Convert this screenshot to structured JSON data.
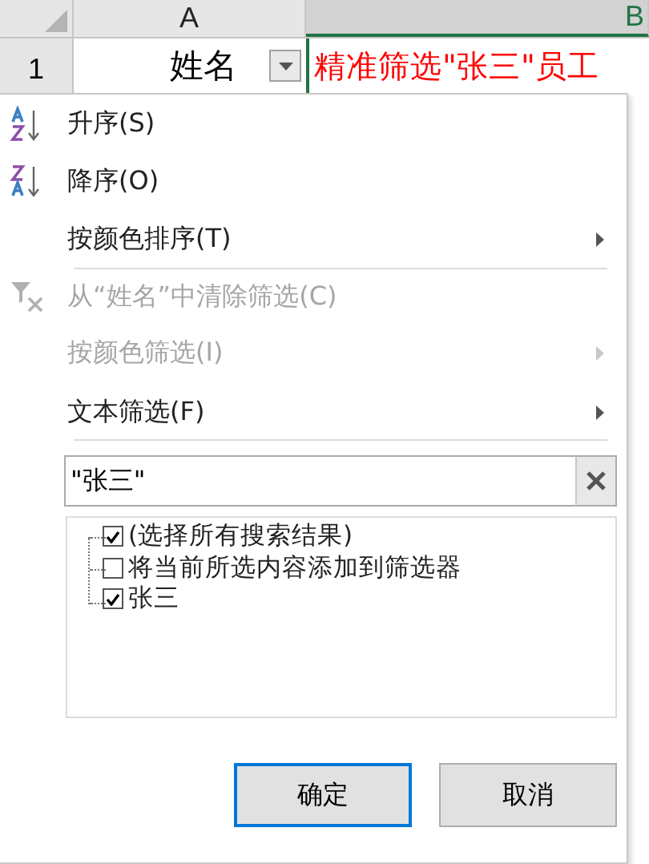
{
  "sheet": {
    "columns": [
      {
        "label": "A",
        "selected": false
      },
      {
        "label": "B",
        "selected": true
      }
    ],
    "row": {
      "number": "1",
      "cells": [
        {
          "text": "姓名",
          "has_filter": true,
          "color": "#000000"
        },
        {
          "text": "精准筛选\"张三\"员工",
          "has_filter": false,
          "color": "#ff0000"
        }
      ]
    }
  },
  "menu": {
    "items": [
      {
        "label": "升序(S)",
        "kind": "sort-ascending",
        "disabled": false,
        "submenu": false,
        "separator_after": false
      },
      {
        "label": "降序(O)",
        "kind": "sort-descending",
        "disabled": false,
        "submenu": false,
        "separator_after": false
      },
      {
        "label": "按颜色排序(T)",
        "kind": "plain",
        "disabled": false,
        "submenu": true,
        "separator_after": true
      },
      {
        "label": "从“姓名”中清除筛选(C)",
        "kind": "clear-filter",
        "disabled": true,
        "submenu": false,
        "separator_after": false
      },
      {
        "label": "按颜色筛选(I)",
        "kind": "plain",
        "disabled": true,
        "submenu": true,
        "separator_after": false
      },
      {
        "label": "文本筛选(F)",
        "kind": "plain",
        "disabled": false,
        "submenu": true,
        "separator_after": true
      }
    ],
    "search": {
      "value": "\"张三\""
    },
    "values": [
      {
        "label": "(选择所有搜索结果)",
        "checked": true
      },
      {
        "label": "将当前所选内容添加到筛选器",
        "checked": false
      },
      {
        "label": "张三",
        "checked": true
      }
    ],
    "buttons": [
      {
        "label": "确定",
        "selected": true
      },
      {
        "label": "取消",
        "selected": false
      }
    ]
  }
}
